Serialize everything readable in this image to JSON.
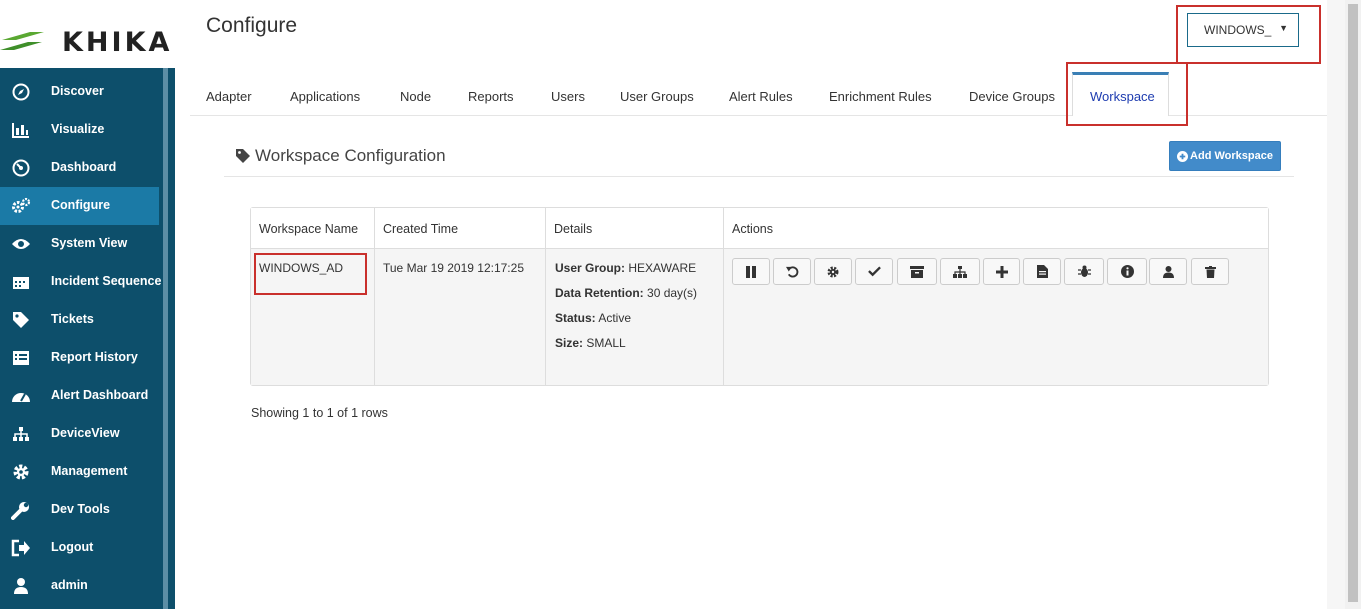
{
  "app": {
    "logo_text": "KHIKA"
  },
  "header": {
    "page_title": "Configure",
    "workspace_select": {
      "value": "WINDOWS_"
    }
  },
  "sidebar": {
    "items": [
      {
        "label": "Discover",
        "icon": "compass-icon"
      },
      {
        "label": "Visualize",
        "icon": "bar-chart-icon"
      },
      {
        "label": "Dashboard",
        "icon": "dashboard-icon"
      },
      {
        "label": "Configure",
        "icon": "gears-icon"
      },
      {
        "label": "System View",
        "icon": "eye-icon"
      },
      {
        "label": "Incident Sequence",
        "icon": "calendar-icon"
      },
      {
        "label": "Tickets",
        "icon": "tag-icon"
      },
      {
        "label": "Report History",
        "icon": "list-alt-icon"
      },
      {
        "label": "Alert Dashboard",
        "icon": "tachometer-icon"
      },
      {
        "label": "DeviceView",
        "icon": "sitemap-icon"
      },
      {
        "label": "Management",
        "icon": "gear-icon"
      },
      {
        "label": "Dev Tools",
        "icon": "wrench-icon"
      },
      {
        "label": "Logout",
        "icon": "sign-out-icon"
      },
      {
        "label": "admin",
        "icon": "user-icon"
      }
    ]
  },
  "tabs": [
    {
      "label": "Adapter"
    },
    {
      "label": "Applications"
    },
    {
      "label": "Node"
    },
    {
      "label": "Reports"
    },
    {
      "label": "Users"
    },
    {
      "label": "User Groups"
    },
    {
      "label": "Alert Rules"
    },
    {
      "label": "Enrichment Rules"
    },
    {
      "label": "Device Groups"
    },
    {
      "label": "Workspace"
    }
  ],
  "panel": {
    "title": "Workspace Configuration",
    "add_button": "Add Workspace"
  },
  "table": {
    "columns": [
      "Workspace Name",
      "Created Time",
      "Details",
      "Actions"
    ],
    "rows": [
      {
        "name": "WINDOWS_AD",
        "created": "Tue Mar 19 2019 12:17:25",
        "details": [
          {
            "key": "User Group:",
            "value": "HEXAWARE"
          },
          {
            "key": "Data Retention:",
            "value": "30 day(s)"
          },
          {
            "key": "Status:",
            "value": "Active"
          },
          {
            "key": "Size:",
            "value": "SMALL"
          }
        ]
      }
    ],
    "actions": [
      "pause-icon",
      "refresh-icon",
      "cog-icon",
      "check-icon",
      "archive-icon",
      "sitemap-icon",
      "plus-icon",
      "file-icon",
      "bug-icon",
      "info-icon",
      "user-icon",
      "trash-icon"
    ]
  },
  "footer": {
    "showing": "Showing 1 to 1 of 1 rows"
  },
  "colors": {
    "sidebar": "#0d4f6b",
    "sidebar_active": "#1b7aa6",
    "accent": "#428bca",
    "highlight": "#c9302c"
  }
}
